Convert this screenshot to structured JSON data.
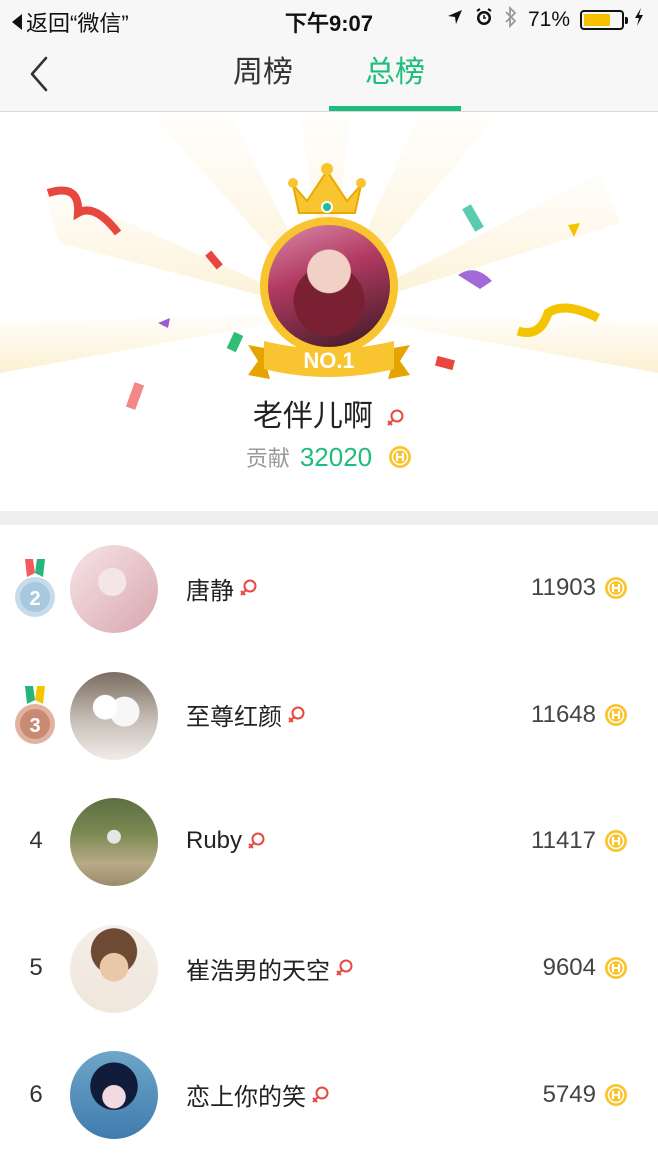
{
  "status_bar": {
    "back_app": "返回“微信”",
    "time": "下午9:07",
    "battery": "71%",
    "battery_level": 0.71
  },
  "nav": {
    "tabs": [
      {
        "label": "周榜",
        "active": false
      },
      {
        "label": "总榜",
        "active": true
      }
    ],
    "accent_color": "#1dbd7b"
  },
  "top_user": {
    "badge": "NO.1",
    "name": "老伴儿啊",
    "contribution_label": "贡献",
    "contribution": "32020"
  },
  "ranking": [
    {
      "rank": "2",
      "name": "唐静",
      "score": "11903",
      "medal": "silver"
    },
    {
      "rank": "3",
      "name": "至尊红颜",
      "score": "11648",
      "medal": "bronze"
    },
    {
      "rank": "4",
      "name": "Ruby",
      "score": "11417"
    },
    {
      "rank": "5",
      "name": "崔浩男的天空",
      "score": "9604"
    },
    {
      "rank": "6",
      "name": "恋上你的笑",
      "score": "5749"
    }
  ]
}
